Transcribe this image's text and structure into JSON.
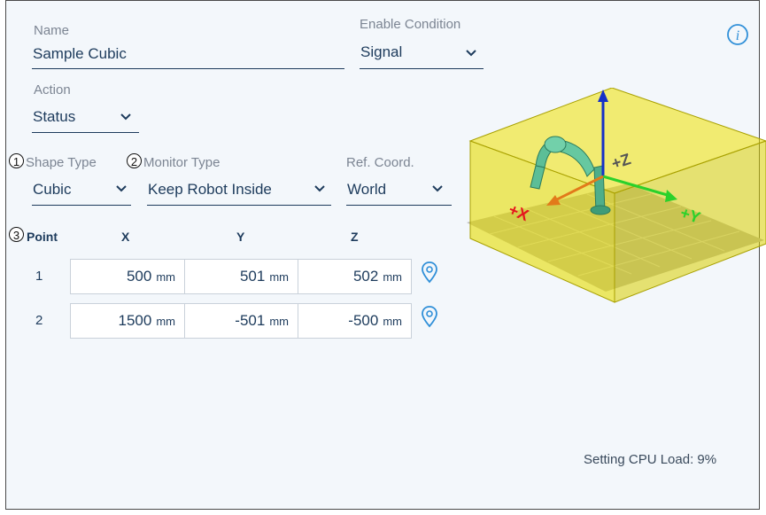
{
  "form": {
    "name": {
      "label": "Name",
      "value": "Sample Cubic"
    },
    "enable_condition": {
      "label": "Enable Condition",
      "value": "Signal"
    },
    "action": {
      "label": "Action",
      "value": "Status"
    },
    "shape_type": {
      "marker": "1",
      "label": "Shape Type",
      "value": "Cubic"
    },
    "monitor_type": {
      "marker": "2",
      "label": "Monitor Type",
      "value": "Keep Robot Inside"
    },
    "ref_coord": {
      "label": "Ref. Coord.",
      "value": "World"
    }
  },
  "points_table": {
    "marker": "3",
    "headers": {
      "point": "Point",
      "x": "X",
      "y": "Y",
      "z": "Z"
    },
    "unit": "mm",
    "rows": [
      {
        "point": "1",
        "x": "500",
        "y": "501",
        "z": "502"
      },
      {
        "point": "2",
        "x": "1500",
        "y": "-501",
        "z": "-500"
      }
    ]
  },
  "preview": {
    "axis_labels": {
      "x": "+X",
      "y": "+Y",
      "z": "+Z"
    },
    "colors": {
      "box": "#e8e400",
      "x_axis": "#e5151d",
      "y_axis": "#2bd12b",
      "z_axis": "#1530c8",
      "robot": "#5fbf9a"
    }
  },
  "icons": {
    "info": "info-icon",
    "pin": "location-pin-icon",
    "dropdown": "chevron-down-icon"
  },
  "status": {
    "cpu_load": "Setting CPU Load: 9%"
  }
}
